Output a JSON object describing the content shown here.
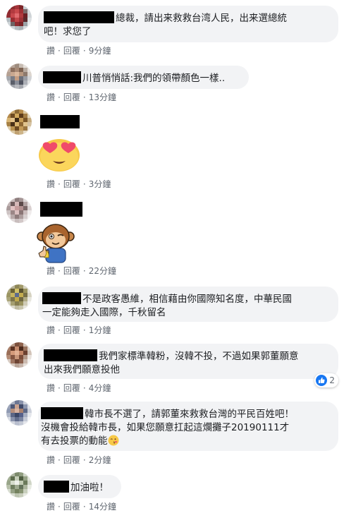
{
  "actions": {
    "like": "讚",
    "reply": "回覆",
    "separator": "·"
  },
  "comments": [
    {
      "text_line1": "總裁，請出来救救台湾人民，出来選總統",
      "text_line2": "吧！求您了",
      "time": "9分鐘"
    },
    {
      "text_line1": "川普悄悄話:我們的領帶顏色一樣..",
      "time": "13分鐘"
    },
    {
      "sticker": "heart-eyes-emoji",
      "time": "3分鐘"
    },
    {
      "sticker": "monkey-thumbs-up-sticker",
      "time": "22分鐘"
    },
    {
      "text_line1": "不是政客愚維，相信藉由你國際知名度，中華民國",
      "text_line2": "一定能夠走入國際，千秋留名",
      "time": "1分鐘"
    },
    {
      "text_line1": "我們家標準韓粉，沒韓不投，不過如果郭董願意",
      "text_line2": "出來我們願意投他",
      "time": "4分鐘",
      "reaction_count": "2",
      "reaction_icon": "like-icon"
    },
    {
      "text_line1": "韓市長不選了，請郭董來救救台灣的平民百姓吧！",
      "text_line2": "沒機會投給韓市長，如果您願意扛起這爛攤子20190111才",
      "text_line3": "有去投票的動能",
      "emoji": "kiss-emoji",
      "time": "2分鐘"
    },
    {
      "text_line1": "加油啦！",
      "time": "14分鐘"
    }
  ]
}
